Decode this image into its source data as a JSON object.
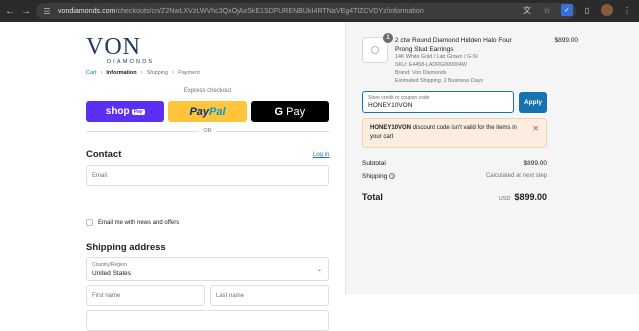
{
  "browser": {
    "url_domain": "vondiamonds.com",
    "url_path": "/checkouts/cn/Z2NwLXVzLWVhc3QxOjAxSkE1SDFURENBUkI4RTNaVEg4TlZCVDYz/information"
  },
  "brand": {
    "logo_main": "VON",
    "logo_sub": "DIAMONDS"
  },
  "breadcrumb": {
    "cart": "Cart",
    "information": "Information",
    "shipping": "Shipping",
    "payment": "Payment",
    "sep": "›"
  },
  "express": {
    "title": "Express checkout",
    "shop_pay": "shop",
    "shop_pay_badge": "Pay",
    "paypal_1": "Pay",
    "paypal_2": "Pal",
    "gpay_g": "G",
    "gpay_label": "Pay",
    "or": "OR"
  },
  "contact": {
    "title": "Contact",
    "login": "Log in",
    "email_placeholder": "Email",
    "news_label": "Email me with news and offers"
  },
  "shipping": {
    "title": "Shipping address",
    "country_label": "Country/Region",
    "country_value": "United States",
    "first_name_placeholder": "First name",
    "last_name_placeholder": "Last name"
  },
  "order": {
    "quantity": "1",
    "product_name": "2 ctw Round Diamond Hidden Halo Four Prong Stud Earrings",
    "price": "$899.00",
    "meta": [
      "14K White Gold / Lab Grown / G-SI",
      "SKU: E4458-LADRG000004W",
      "Brand: Von Diamonds",
      "Estimated Shipping: 2 Business Days"
    ]
  },
  "discount": {
    "label": "Store credit or coupon code",
    "value": "HONEY10VON",
    "apply": "Apply",
    "error_code": "HONEY10VON",
    "error_message": " discount code isn't valid for the items in your cart"
  },
  "summary": {
    "subtotal_label": "Subtotal",
    "subtotal_value": "$899.00",
    "shipping_label": "Shipping",
    "shipping_value": "Calculated at next step",
    "total_label": "Total",
    "total_currency": "USD",
    "total_value": "$899.00"
  },
  "colors": {
    "accent": "#1773b0",
    "shop_pay": "#5a31f4",
    "paypal": "#ffc439",
    "error_bg": "#fbeee0"
  }
}
